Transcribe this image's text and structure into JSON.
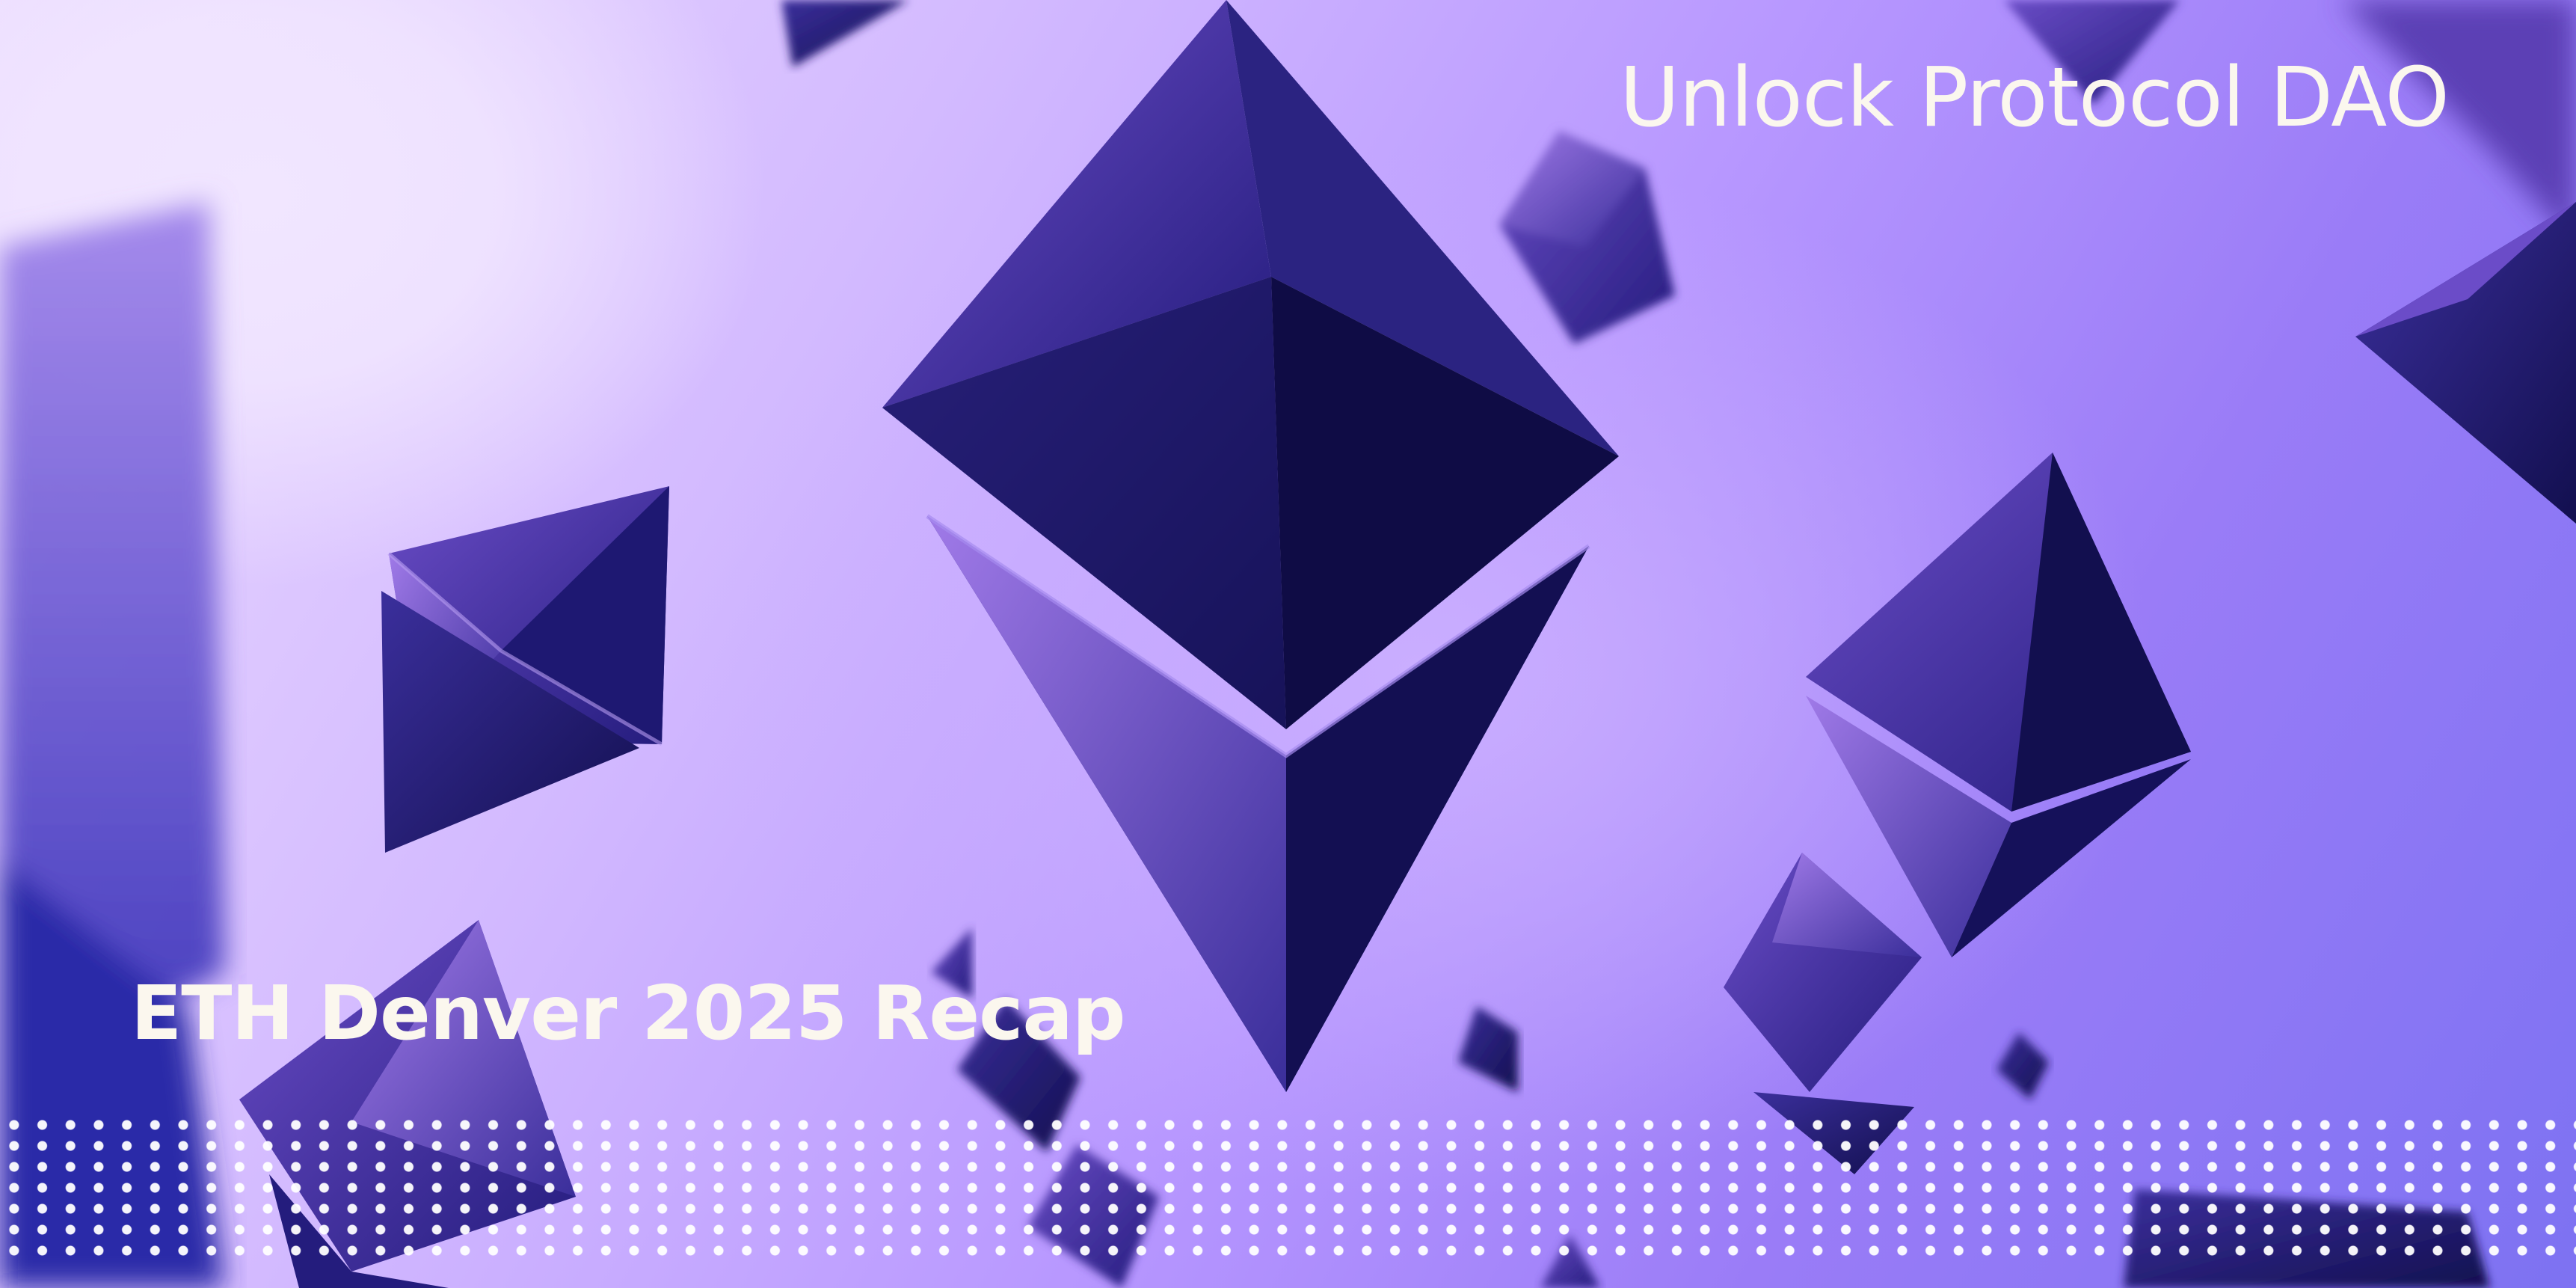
{
  "banner": {
    "brand": "Unlock Protocol DAO",
    "title": "ETH Denver 2025 Recap"
  },
  "colors": {
    "text": "#fbf7ee",
    "crystal_dark": "#1f1a6e",
    "crystal_mid": "#3a2e9a",
    "crystal_light": "#8a63d8",
    "background_light": "#ecdcff",
    "background_deep": "#7d72f2"
  },
  "icons": {
    "crystals": "ethereum-diamond-icon",
    "pattern": "dot-grid-pattern"
  }
}
